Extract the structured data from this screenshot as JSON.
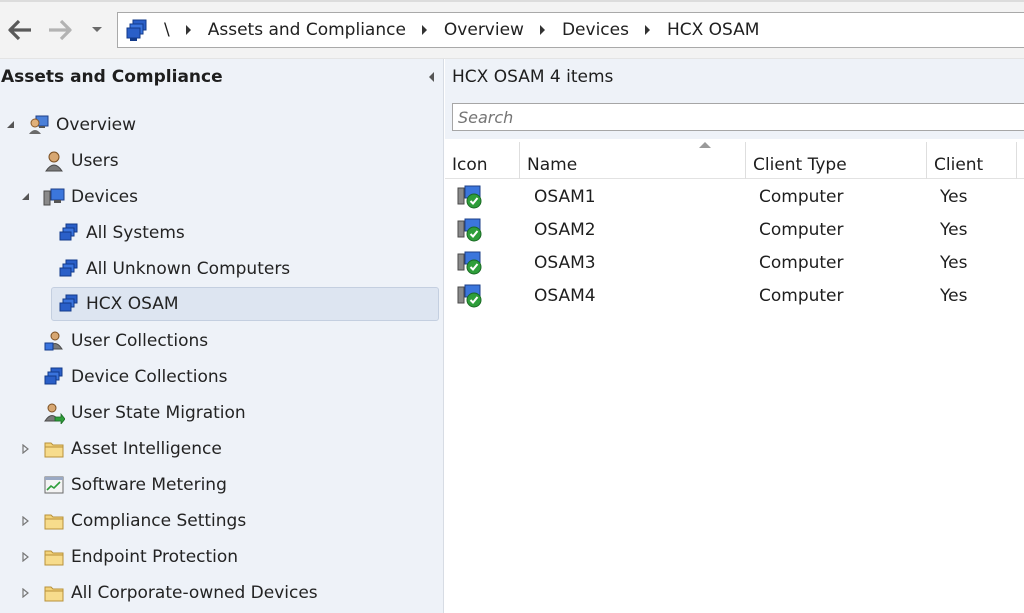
{
  "addressbar": {
    "root_separator": "\\",
    "crumbs": [
      "Assets and Compliance",
      "Overview",
      "Devices",
      "HCX OSAM"
    ]
  },
  "navpane": {
    "title": "Assets and Compliance",
    "items": [
      {
        "label": "Overview",
        "icon": "overview-icon",
        "expander": "expanded"
      },
      {
        "label": "Users",
        "icon": "users-icon",
        "expander": "none"
      },
      {
        "label": "Devices",
        "icon": "devices-icon",
        "expander": "expanded"
      },
      {
        "label": "All Systems",
        "icon": "collection-icon",
        "expander": "none"
      },
      {
        "label": "All Unknown Computers",
        "icon": "collection-icon",
        "expander": "none"
      },
      {
        "label": "HCX OSAM",
        "icon": "collection-icon",
        "expander": "none",
        "selected": true
      },
      {
        "label": "User Collections",
        "icon": "user-collections-icon",
        "expander": "none"
      },
      {
        "label": "Device Collections",
        "icon": "device-collections-icon",
        "expander": "none"
      },
      {
        "label": "User State Migration",
        "icon": "user-state-migration-icon",
        "expander": "none"
      },
      {
        "label": "Asset Intelligence",
        "icon": "folder-icon",
        "expander": "collapsed"
      },
      {
        "label": "Software Metering",
        "icon": "software-metering-icon",
        "expander": "none"
      },
      {
        "label": "Compliance Settings",
        "icon": "folder-icon",
        "expander": "collapsed"
      },
      {
        "label": "Endpoint Protection",
        "icon": "folder-icon",
        "expander": "collapsed"
      },
      {
        "label": "All Corporate-owned Devices",
        "icon": "folder-icon",
        "expander": "collapsed"
      }
    ]
  },
  "content": {
    "title": "HCX OSAM 4 items",
    "search_placeholder": "Search",
    "columns": [
      "Icon",
      "Name",
      "Client Type",
      "Client"
    ],
    "rows": [
      {
        "icon": "managed-computer-icon",
        "name": "OSAM1",
        "client_type": "Computer",
        "client": "Yes"
      },
      {
        "icon": "managed-computer-icon",
        "name": "OSAM2",
        "client_type": "Computer",
        "client": "Yes"
      },
      {
        "icon": "managed-computer-icon",
        "name": "OSAM3",
        "client_type": "Computer",
        "client": "Yes"
      },
      {
        "icon": "managed-computer-icon",
        "name": "OSAM4",
        "client_type": "Computer",
        "client": "Yes"
      }
    ]
  },
  "colors": {
    "pane_background": "#eef2f8",
    "selection_background": "#dde5f1",
    "check_green": "#2e9e3a",
    "collection_blue": "#1f4fb5"
  }
}
